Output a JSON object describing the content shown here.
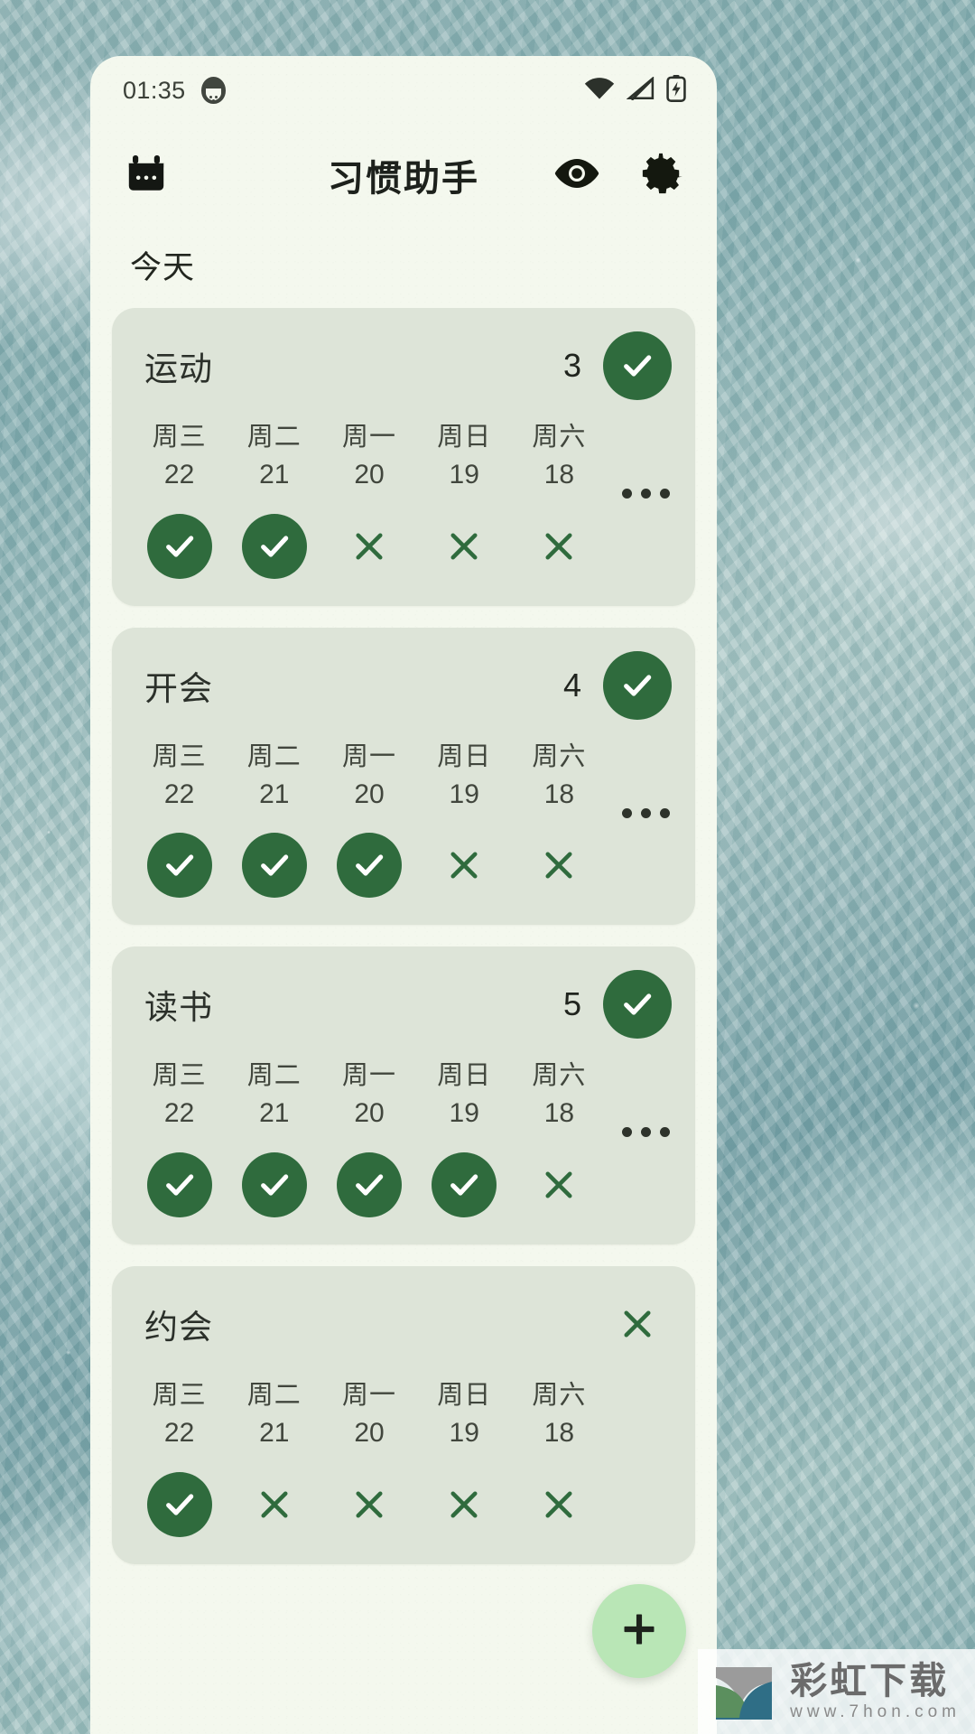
{
  "status_bar": {
    "time": "01:35",
    "notification_icon": "app-notification-icon",
    "wifi_icon": "wifi-icon",
    "signal_icon": "cellular-signal-icon",
    "battery_icon": "battery-charging-icon"
  },
  "app_bar": {
    "calendar_icon": "calendar-icon",
    "title": "习惯助手",
    "eye_icon": "eye-icon",
    "settings_icon": "gear-icon"
  },
  "section": {
    "today_label": "今天"
  },
  "colors": {
    "accent_green": "#2f6b3d",
    "card_bg": "#dde4d8",
    "app_bg": "#f4f8ee",
    "fab_bg": "#b9e6b6"
  },
  "habits": [
    {
      "name": "运动",
      "count": "3",
      "today_state": "done",
      "more_label": "...",
      "days": [
        {
          "weekday": "周三",
          "date": "22",
          "state": "done"
        },
        {
          "weekday": "周二",
          "date": "21",
          "state": "done"
        },
        {
          "weekday": "周一",
          "date": "20",
          "state": "missed"
        },
        {
          "weekday": "周日",
          "date": "19",
          "state": "missed"
        },
        {
          "weekday": "周六",
          "date": "18",
          "state": "missed"
        }
      ]
    },
    {
      "name": "开会",
      "count": "4",
      "today_state": "done",
      "more_label": "...",
      "days": [
        {
          "weekday": "周三",
          "date": "22",
          "state": "done"
        },
        {
          "weekday": "周二",
          "date": "21",
          "state": "done"
        },
        {
          "weekday": "周一",
          "date": "20",
          "state": "done"
        },
        {
          "weekday": "周日",
          "date": "19",
          "state": "missed"
        },
        {
          "weekday": "周六",
          "date": "18",
          "state": "missed"
        }
      ]
    },
    {
      "name": "读书",
      "count": "5",
      "today_state": "done",
      "more_label": "...",
      "days": [
        {
          "weekday": "周三",
          "date": "22",
          "state": "done"
        },
        {
          "weekday": "周二",
          "date": "21",
          "state": "done"
        },
        {
          "weekday": "周一",
          "date": "20",
          "state": "done"
        },
        {
          "weekday": "周日",
          "date": "19",
          "state": "done"
        },
        {
          "weekday": "周六",
          "date": "18",
          "state": "missed"
        }
      ]
    },
    {
      "name": "约会",
      "count": "",
      "today_state": "missed",
      "more_label": "",
      "days": [
        {
          "weekday": "周三",
          "date": "22",
          "state": "done"
        },
        {
          "weekday": "周二",
          "date": "21",
          "state": "missed"
        },
        {
          "weekday": "周一",
          "date": "20",
          "state": "missed"
        },
        {
          "weekday": "周日",
          "date": "19",
          "state": "missed"
        },
        {
          "weekday": "周六",
          "date": "18",
          "state": "missed"
        }
      ]
    }
  ],
  "fab": {
    "label": "+",
    "icon": "plus-icon"
  },
  "watermark": {
    "name": "彩虹下载",
    "url": "www.7hon.com",
    "logo_icon": "rainbow-download-logo"
  }
}
